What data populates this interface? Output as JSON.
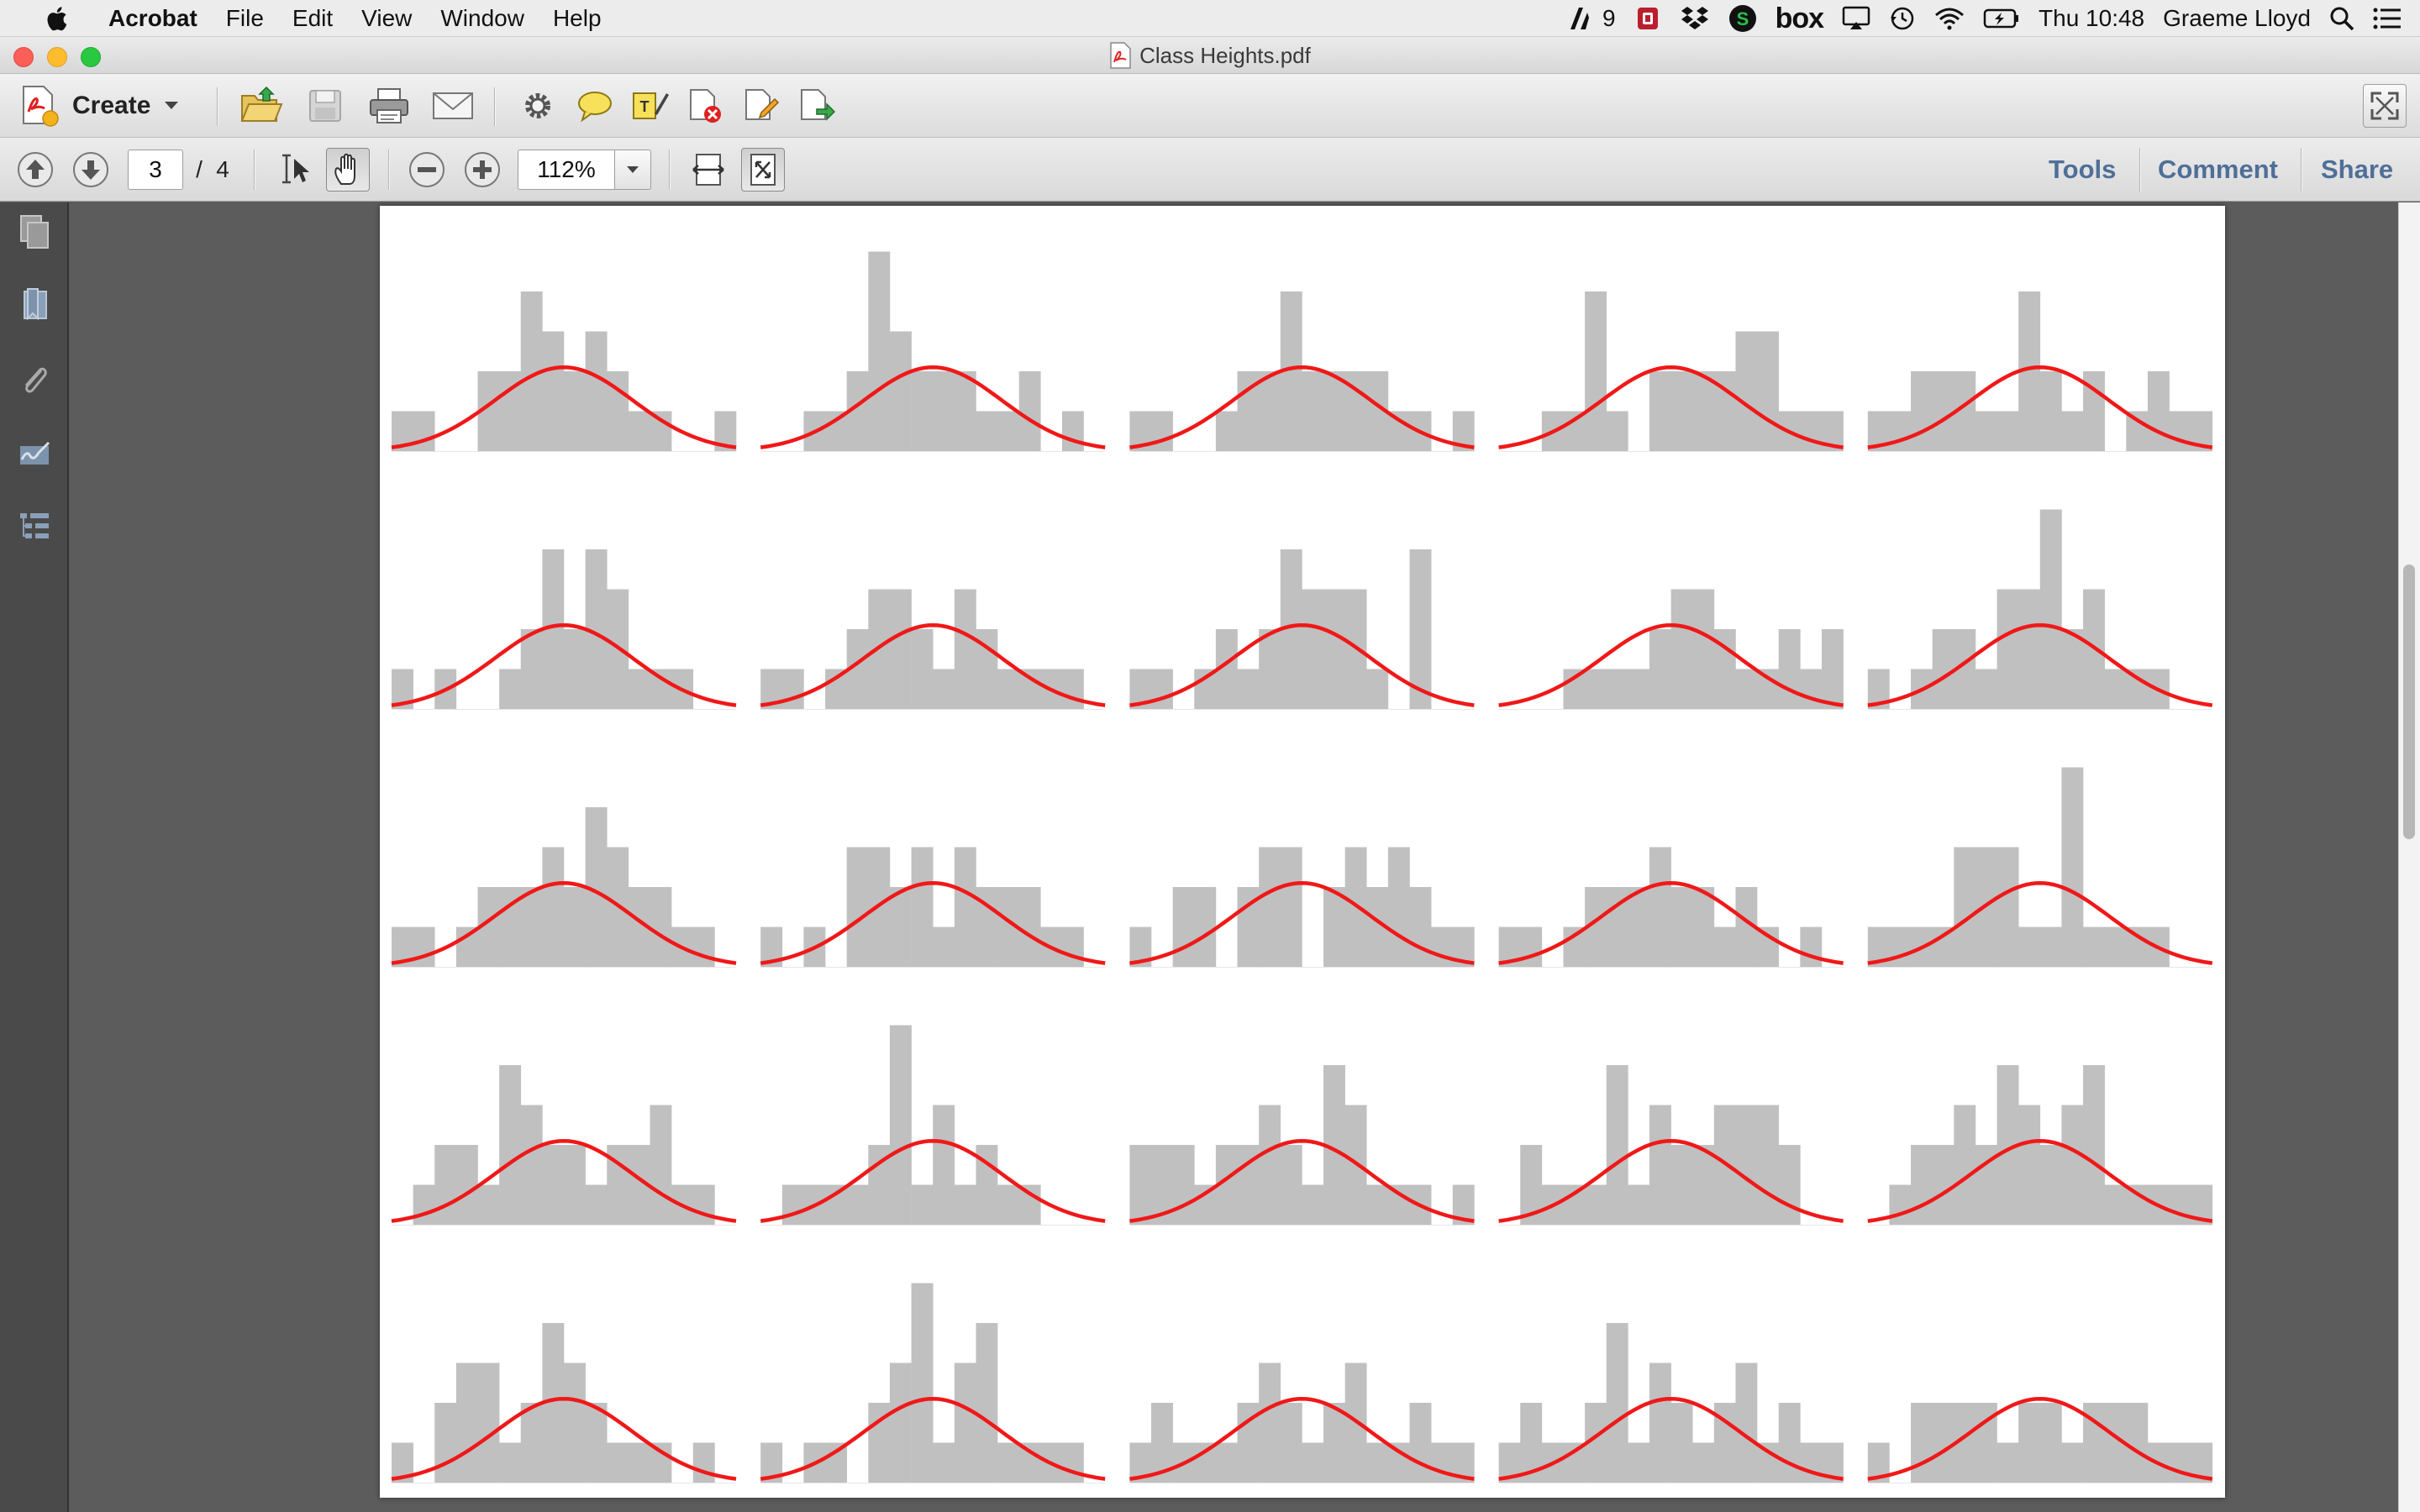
{
  "menubar": {
    "app_name": "Acrobat",
    "menus": [
      "File",
      "Edit",
      "View",
      "Window",
      "Help"
    ],
    "status": {
      "adobe_count": "9",
      "box_label": "box",
      "clock": "Thu 10:48",
      "user": "Graeme Lloyd"
    }
  },
  "window": {
    "title": "Class Heights.pdf"
  },
  "toolbar": {
    "create_label": "Create",
    "icons": [
      "open-icon",
      "save-icon",
      "print-icon",
      "email-icon",
      "settings-icon",
      "comment-icon",
      "highlight-icon",
      "redact-icon",
      "sign-icon",
      "export-icon"
    ],
    "expand_icon": "fullscreen-icon"
  },
  "navigation": {
    "current_page": "3",
    "page_separator": "/",
    "total_pages": "4",
    "zoom": "112%",
    "tools_label": "Tools",
    "comment_label": "Comment",
    "share_label": "Share"
  },
  "side_pane": {
    "icons": [
      "pages-icon",
      "bookmark-icon",
      "attachment-icon",
      "signature-icon",
      "layers-icon"
    ]
  },
  "scrollbar": {
    "position": 0.35,
    "visible_fraction": 0.21
  },
  "colors": {
    "bar": "#c0c0c0",
    "curve": "#f01818",
    "page": "#ffffff",
    "link": "#4f6f98"
  },
  "chart_data": {
    "type": "bar",
    "description_rows": 5,
    "description_cols": 5,
    "bins_per_histogram": 16,
    "ylim": [
      0,
      5
    ],
    "overlay": "normal-curve",
    "curve_peak": 2.1,
    "curve_spread": 3.2,
    "histograms": [
      {
        "values": [
          1,
          1,
          0,
          0,
          2,
          2,
          4,
          3,
          2,
          3,
          2,
          1,
          1,
          0,
          0,
          1
        ]
      },
      {
        "values": [
          0,
          0,
          1,
          1,
          2,
          5,
          3,
          2,
          2,
          2,
          1,
          1,
          2,
          0,
          1,
          0
        ]
      },
      {
        "values": [
          1,
          1,
          0,
          0,
          1,
          2,
          2,
          4,
          2,
          2,
          2,
          2,
          1,
          1,
          0,
          1
        ]
      },
      {
        "values": [
          0,
          0,
          1,
          1,
          4,
          1,
          0,
          2,
          2,
          2,
          2,
          3,
          3,
          1,
          1,
          1
        ]
      },
      {
        "values": [
          1,
          1,
          2,
          2,
          2,
          1,
          1,
          4,
          2,
          1,
          2,
          0,
          1,
          2,
          1,
          1
        ]
      },
      {
        "values": [
          1,
          0,
          1,
          0,
          0,
          1,
          2,
          4,
          2,
          4,
          3,
          1,
          1,
          1,
          0,
          0
        ]
      },
      {
        "values": [
          1,
          1,
          0,
          1,
          2,
          3,
          3,
          2,
          1,
          3,
          2,
          1,
          1,
          1,
          1,
          0
        ]
      },
      {
        "values": [
          1,
          1,
          0,
          1,
          2,
          1,
          2,
          4,
          3,
          3,
          3,
          1,
          0,
          4,
          0,
          0
        ]
      },
      {
        "values": [
          0,
          0,
          0,
          1,
          1,
          1,
          1,
          2,
          3,
          3,
          2,
          1,
          1,
          2,
          1,
          2
        ]
      },
      {
        "values": [
          1,
          0,
          1,
          2,
          2,
          1,
          3,
          3,
          5,
          2,
          3,
          1,
          1,
          1,
          0,
          0
        ]
      },
      {
        "values": [
          1,
          1,
          0,
          1,
          2,
          2,
          2,
          3,
          2,
          4,
          3,
          2,
          2,
          1,
          1,
          0
        ]
      },
      {
        "values": [
          1,
          0,
          1,
          0,
          3,
          3,
          2,
          3,
          1,
          3,
          2,
          2,
          2,
          1,
          1,
          0
        ]
      },
      {
        "values": [
          1,
          0,
          2,
          2,
          0,
          2,
          3,
          3,
          0,
          2,
          3,
          2,
          3,
          2,
          1,
          1
        ]
      },
      {
        "values": [
          1,
          1,
          0,
          1,
          2,
          2,
          2,
          3,
          2,
          2,
          1,
          2,
          1,
          0,
          1,
          0
        ]
      },
      {
        "values": [
          1,
          1,
          1,
          1,
          3,
          3,
          3,
          1,
          1,
          5,
          1,
          1,
          1,
          1,
          0,
          0
        ]
      },
      {
        "values": [
          0,
          1,
          2,
          2,
          1,
          4,
          3,
          2,
          2,
          1,
          2,
          2,
          3,
          1,
          1,
          0
        ]
      },
      {
        "values": [
          0,
          1,
          1,
          1,
          1,
          2,
          5,
          1,
          3,
          1,
          2,
          1,
          1,
          0,
          0,
          0
        ]
      },
      {
        "values": [
          2,
          2,
          2,
          1,
          2,
          2,
          3,
          2,
          1,
          4,
          3,
          1,
          1,
          1,
          0,
          1
        ]
      },
      {
        "values": [
          0,
          2,
          1,
          1,
          1,
          4,
          1,
          3,
          2,
          2,
          3,
          3,
          3,
          2,
          0,
          0
        ]
      },
      {
        "values": [
          0,
          1,
          2,
          2,
          3,
          2,
          4,
          3,
          2,
          3,
          4,
          1,
          1,
          1,
          1,
          1
        ]
      },
      {
        "values": [
          1,
          0,
          2,
          3,
          3,
          1,
          2,
          4,
          3,
          2,
          1,
          1,
          1,
          0,
          1,
          0
        ]
      },
      {
        "values": [
          1,
          0,
          1,
          1,
          0,
          2,
          3,
          5,
          1,
          3,
          4,
          1,
          1,
          1,
          1,
          0
        ]
      },
      {
        "values": [
          1,
          2,
          1,
          1,
          1,
          2,
          3,
          2,
          1,
          2,
          3,
          1,
          1,
          2,
          1,
          1
        ]
      },
      {
        "values": [
          1,
          2,
          1,
          1,
          2,
          4,
          1,
          3,
          2,
          1,
          2,
          3,
          1,
          2,
          1,
          1
        ]
      },
      {
        "values": [
          1,
          0,
          2,
          2,
          2,
          2,
          1,
          2,
          2,
          1,
          2,
          2,
          2,
          1,
          1,
          1
        ]
      }
    ]
  }
}
